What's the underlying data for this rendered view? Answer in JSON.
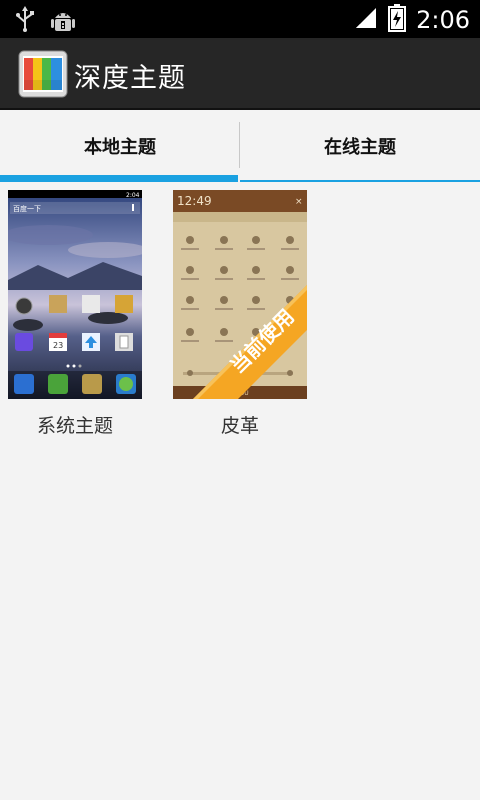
{
  "status_bar": {
    "time": "2:06",
    "icons": [
      "usb-icon",
      "android-debug-icon",
      "signal-icon",
      "battery-charging-icon"
    ]
  },
  "app_bar": {
    "title": "深度主题",
    "icon": "theme-app-icon"
  },
  "tabs": [
    {
      "label": "本地主题",
      "selected": true
    },
    {
      "label": "在线主题",
      "selected": false
    }
  ],
  "themes": [
    {
      "name": "系统主题",
      "preview": {
        "status_time": "2:04",
        "search_text": "百度一下",
        "calendar_day": "23"
      }
    },
    {
      "name": "皮革",
      "current": true,
      "badge": "当前使用",
      "preview": {
        "clock": "12:49",
        "brand": "SHENDU"
      }
    }
  ],
  "colors": {
    "accent": "#1aa1e1",
    "status_bar": "#000000",
    "action_bar": "#262626",
    "background": "#f3f3f3",
    "badge": "#f5a623"
  }
}
